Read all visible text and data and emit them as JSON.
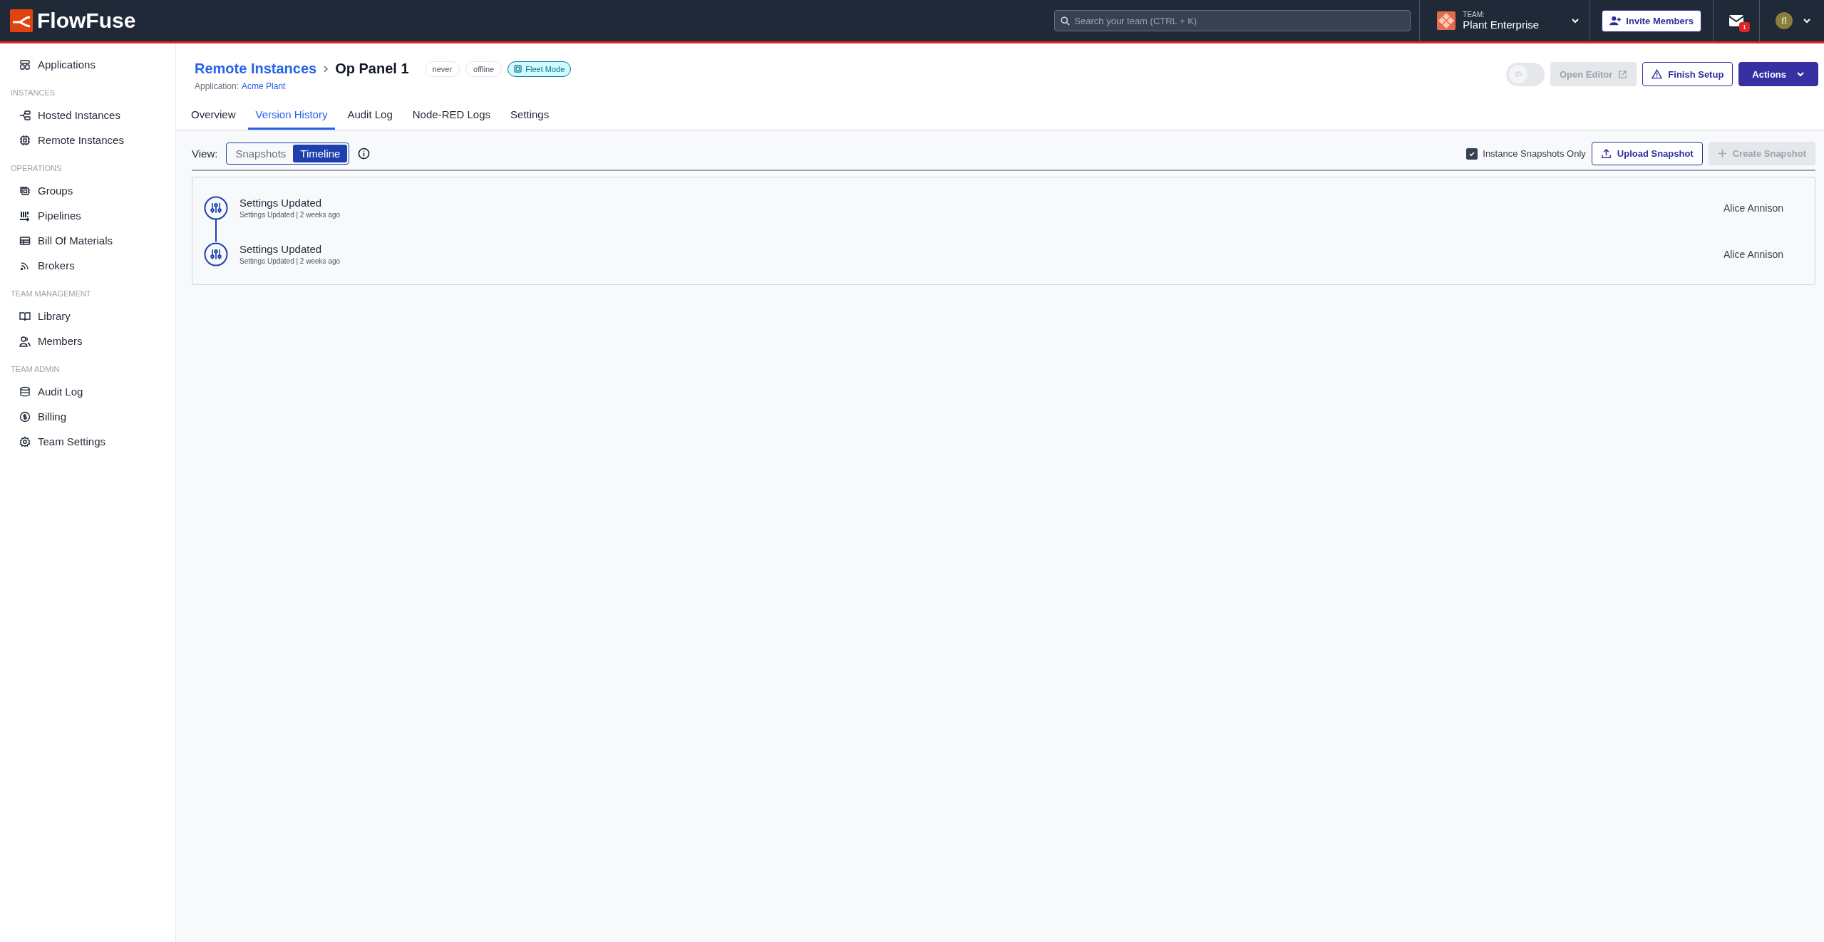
{
  "topbar": {
    "logo_text": "FlowFuse",
    "search": {
      "placeholder": "Search your team (CTRL + K)"
    },
    "team": {
      "label": "TEAM:",
      "name": "Plant Enterprise"
    },
    "invite_button": "Invite Members",
    "notifications": {
      "count": "1"
    },
    "avatar": {
      "initials": "fl"
    }
  },
  "sidebar": {
    "sections": [
      {
        "items": [
          {
            "label": "Applications"
          }
        ]
      },
      {
        "heading": "INSTANCES",
        "items": [
          {
            "label": "Hosted Instances"
          },
          {
            "label": "Remote Instances"
          }
        ]
      },
      {
        "heading": "OPERATIONS",
        "items": [
          {
            "label": "Groups"
          },
          {
            "label": "Pipelines"
          },
          {
            "label": "Bill Of Materials"
          },
          {
            "label": "Brokers"
          }
        ]
      },
      {
        "heading": "TEAM MANAGEMENT",
        "items": [
          {
            "label": "Library"
          },
          {
            "label": "Members"
          }
        ]
      },
      {
        "heading": "TEAM ADMIN",
        "items": [
          {
            "label": "Audit Log"
          },
          {
            "label": "Billing"
          },
          {
            "label": "Team Settings"
          }
        ]
      }
    ]
  },
  "page_header": {
    "breadcrumb_parent": "Remote Instances",
    "title": "Op Panel 1",
    "badges": [
      {
        "text": "never",
        "kind": "plain"
      },
      {
        "text": "offline",
        "kind": "plain"
      },
      {
        "text": "Fleet Mode",
        "kind": "fleet"
      }
    ],
    "application_label": "Application:",
    "application_link": "Acme Plant",
    "actions": [
      {
        "kind": "toggle",
        "on": false,
        "disabled": true
      },
      {
        "label": "Open Editor",
        "kind": "external",
        "disabled": true
      },
      {
        "label": "Finish Setup",
        "kind": "warning",
        "disabled": false
      },
      {
        "label": "Actions",
        "kind": "primary",
        "disabled": false
      }
    ]
  },
  "tabs": [
    {
      "label": "Overview",
      "selected": false
    },
    {
      "label": "Version History",
      "selected": true
    },
    {
      "label": "Audit Log",
      "selected": false
    },
    {
      "label": "Node-RED Logs",
      "selected": false
    },
    {
      "label": "Settings",
      "selected": false
    }
  ],
  "toolbar": {
    "view_label": "View:",
    "view_options": [
      {
        "label": "Snapshots",
        "selected": false
      },
      {
        "label": "Timeline",
        "selected": true
      }
    ],
    "filter": {
      "label": "Instance Snapshots Only",
      "checked": true
    },
    "buttons": [
      {
        "label": "Upload Snapshot",
        "kind": "upload",
        "disabled": false
      },
      {
        "label": "Create Snapshot",
        "kind": "create",
        "disabled": true
      }
    ]
  },
  "timeline": [
    {
      "title": "Settings Updated",
      "detail": "Settings Updated | 2 weeks ago",
      "user": "Alice Annison"
    },
    {
      "title": "Settings Updated",
      "detail": "Settings Updated | 2 weeks ago",
      "user": "Alice Annison"
    }
  ]
}
